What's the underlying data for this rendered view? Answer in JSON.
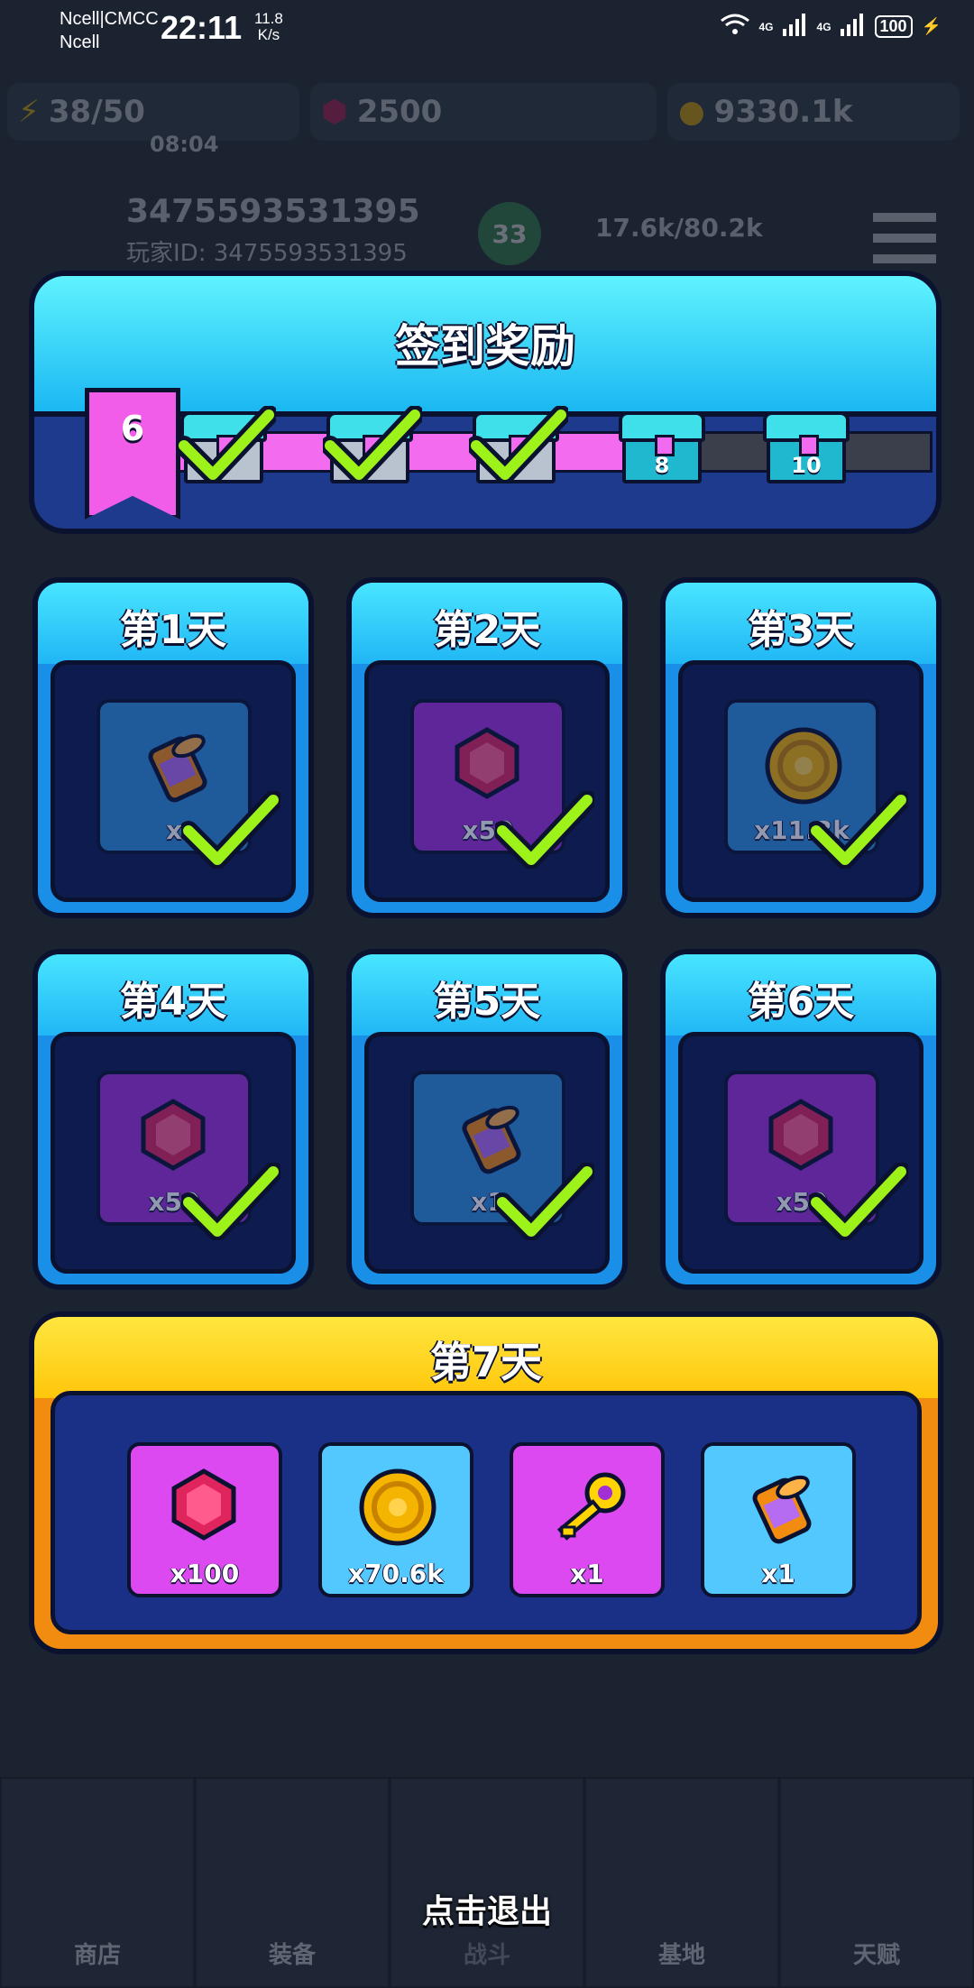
{
  "status_bar": {
    "carrier_line1": "Ncell|CMCC",
    "carrier_line2": "Ncell",
    "time": "22:11",
    "speed_value": "11.8",
    "speed_unit": "K/s",
    "network1": "4G",
    "network2": "4G",
    "battery": "100"
  },
  "background": {
    "energy": "38/50",
    "timer": "08:04",
    "gems": "2500",
    "coins": "9330.1k",
    "player_name": "3475593531395",
    "player_id": "玩家ID: 3475593531395",
    "level": "33",
    "xp": "17.6k/80.2k",
    "nav": [
      "商店",
      "装备",
      "战斗",
      "基地",
      "天赋"
    ]
  },
  "signin": {
    "title": "签到奖励",
    "current_day": "6",
    "progress_fraction": 0.62,
    "chests": [
      {
        "label": "",
        "claimed": true
      },
      {
        "label": "",
        "claimed": true
      },
      {
        "label": "",
        "claimed": true
      },
      {
        "label": "8",
        "claimed": false
      },
      {
        "label": "10",
        "claimed": false
      }
    ],
    "days": [
      {
        "label": "第1天",
        "item": "scroll",
        "amount": "x",
        "color": "blue",
        "claimed": true
      },
      {
        "label": "第2天",
        "item": "gem",
        "amount": "x50",
        "color": "purple",
        "claimed": true
      },
      {
        "label": "第3天",
        "item": "coin",
        "amount": "x11.3k",
        "color": "blue",
        "claimed": true
      },
      {
        "label": "第4天",
        "item": "gem",
        "amount": "x50",
        "color": "purple",
        "claimed": true
      },
      {
        "label": "第5天",
        "item": "scroll",
        "amount": "x1",
        "color": "blue",
        "claimed": true
      },
      {
        "label": "第6天",
        "item": "gem",
        "amount": "x50",
        "color": "purple",
        "claimed": true
      }
    ],
    "day7": {
      "label": "第7天",
      "items": [
        {
          "item": "gem",
          "amount": "x100",
          "color": "pink"
        },
        {
          "item": "coin",
          "amount": "x70.6k",
          "color": "light"
        },
        {
          "item": "key",
          "amount": "x1",
          "color": "pink"
        },
        {
          "item": "scroll",
          "amount": "x1",
          "color": "light"
        }
      ]
    },
    "exit_label": "点击退出"
  }
}
